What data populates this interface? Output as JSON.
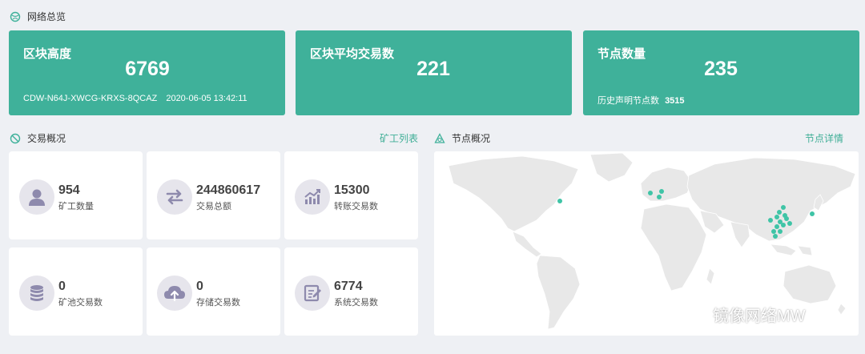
{
  "overview": {
    "title": "网络总览"
  },
  "cards": {
    "block_height": {
      "title": "区块高度",
      "value": "6769",
      "hash": "CDW-N64J-XWCG-KRXS-8QCAZ",
      "time": "2020-06-05 13:42:11"
    },
    "avg_tx": {
      "title": "区块平均交易数",
      "value": "221"
    },
    "nodes": {
      "title": "节点数量",
      "value": "235",
      "history_label": "历史声明节点数",
      "history_value": "3515"
    }
  },
  "tx_section": {
    "title": "交易概况",
    "link": "矿工列表"
  },
  "node_section": {
    "title": "节点概况",
    "link": "节点详情"
  },
  "stats": [
    {
      "value": "954",
      "label": "矿工数量",
      "icon": "user-icon"
    },
    {
      "value": "244860617",
      "label": "交易总额",
      "icon": "transfer-icon"
    },
    {
      "value": "15300",
      "label": "转账交易数",
      "icon": "trend-chart-icon"
    },
    {
      "value": "0",
      "label": "矿池交易数",
      "icon": "database-icon"
    },
    {
      "value": "0",
      "label": "存储交易数",
      "icon": "cloud-upload-icon"
    },
    {
      "value": "6774",
      "label": "系统交易数",
      "icon": "edit-document-icon"
    }
  ],
  "colors": {
    "accent": "#3fb19a",
    "background": "#eef0f4",
    "icon_bg": "#e6e5ec",
    "icon_fg": "#8e8aad",
    "node_dot": "#3fc4a6"
  },
  "watermark": {
    "text": "镜像网络MW"
  }
}
